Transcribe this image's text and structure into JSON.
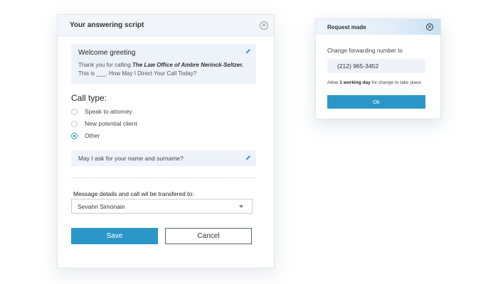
{
  "script_dialog": {
    "title": "Your answering script",
    "greeting": {
      "title": "Welcome greeting",
      "text_prefix": "Thank you for calling ",
      "firm_name": "The Law Office of Ambre Nerinck-Seltzer.",
      "text_suffix": "This is ___. How May I Direct Your Call Today?"
    },
    "call_type": {
      "title": "Call type:",
      "options": [
        {
          "label": "Speak to attorney",
          "selected": false
        },
        {
          "label": "New potential client",
          "selected": false
        },
        {
          "label": "Other",
          "selected": true
        }
      ]
    },
    "question": "May I ask for your name and surname?",
    "transfer_label": "Message details and call wil  be transfered to:",
    "transfer_select_value": "Sevahn Simonain",
    "save_label": "Save",
    "cancel_label": "Cancel"
  },
  "request_dialog": {
    "title": "Request made",
    "forward_label": "Change forwarding number to",
    "phone_number": "(212) 965-3452",
    "note_prefix": "Allow ",
    "note_bold": "1 working day",
    "note_suffix": " for change to take place",
    "ok_label": "Ok"
  },
  "icons": {
    "close": "close-icon",
    "edit": "pencil-icon",
    "dropdown": "chevron-down-icon"
  },
  "colors": {
    "accent": "#2b97c8",
    "card_bg": "#eef3fa",
    "header_bg": "#f2f5fa"
  }
}
